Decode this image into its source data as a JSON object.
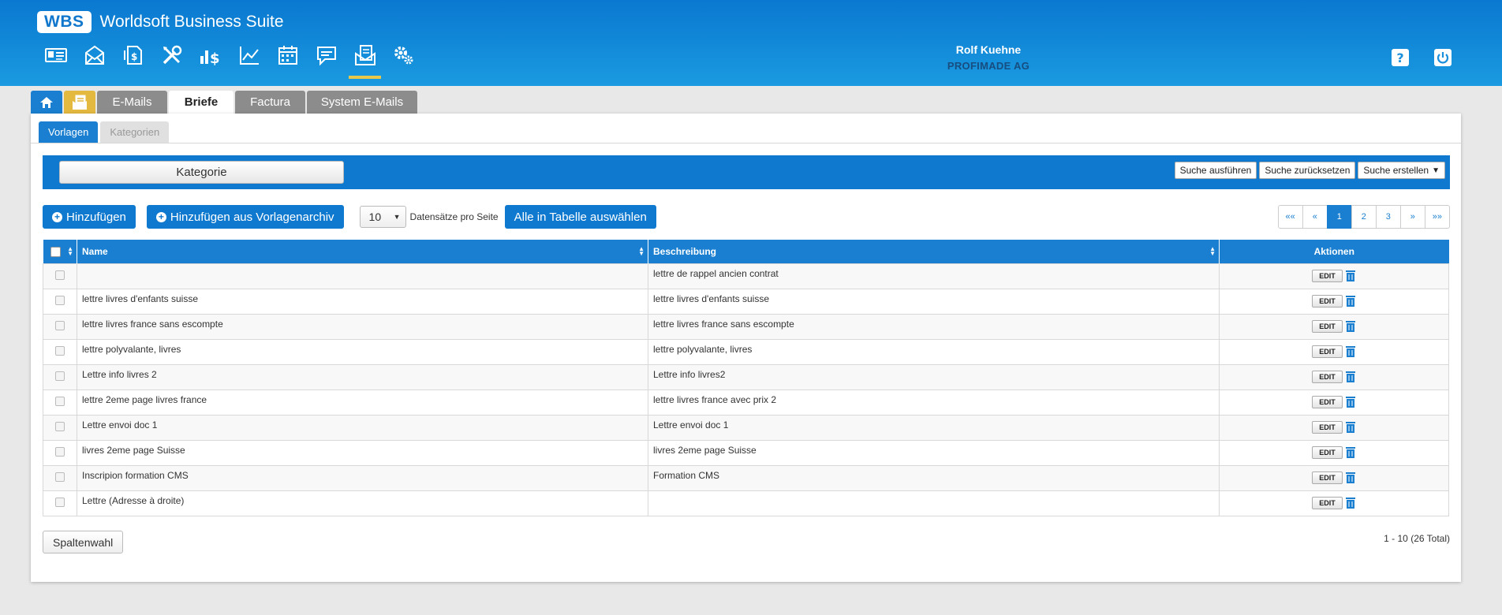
{
  "app": {
    "logo": "WBS",
    "title": "Worldsoft Business Suite"
  },
  "nav_icons": [
    "contact-card-icon",
    "mail-icon",
    "invoice-icon",
    "tools-icon",
    "finance-icon",
    "chart-icon",
    "calendar-icon",
    "comment-icon",
    "letters-icon",
    "settings-icon"
  ],
  "user": {
    "name": "Rolf Kuehne",
    "company": "PROFIMADE AG"
  },
  "top_tabs": {
    "emails": "E-Mails",
    "briefe": "Briefe",
    "factura": "Factura",
    "system": "System E-Mails"
  },
  "sub_tabs": {
    "vorlagen": "Vorlagen",
    "kategorien": "Kategorien"
  },
  "filter": {
    "kategorie": "Kategorie",
    "run": "Suche ausführen",
    "reset": "Suche zurücksetzen",
    "create": "Suche erstellen"
  },
  "toolbar": {
    "add": "Hinzufügen",
    "add_archive": "Hinzufügen aus Vorlagenarchiv",
    "per_page": "10",
    "per_page_label": "Datensätze pro Seite",
    "select_all": "Alle in Tabelle auswählen"
  },
  "pager": {
    "first": "««",
    "prev": "«",
    "p1": "1",
    "p2": "2",
    "p3": "3",
    "next": "»",
    "last": "»»"
  },
  "table": {
    "headers": {
      "name": "Name",
      "description": "Beschreibung",
      "actions": "Aktionen"
    },
    "edit_label": "EDIT",
    "rows": [
      {
        "name": "",
        "description": "lettre de rappel ancien contrat"
      },
      {
        "name": "lettre livres d'enfants suisse",
        "description": "lettre livres d'enfants suisse"
      },
      {
        "name": "lettre livres france sans escompte",
        "description": "lettre livres france sans escompte"
      },
      {
        "name": "lettre polyvalante, livres",
        "description": "lettre polyvalante, livres"
      },
      {
        "name": "Lettre info livres 2",
        "description": "Lettre info livres2"
      },
      {
        "name": "lettre 2eme page livres france",
        "description": "lettre livres france avec prix 2"
      },
      {
        "name": "Lettre envoi doc 1",
        "description": "Lettre envoi doc 1"
      },
      {
        "name": "livres 2eme page Suisse",
        "description": "livres 2eme page Suisse"
      },
      {
        "name": "Inscripion formation CMS",
        "description": "Formation CMS"
      },
      {
        "name": "Lettre (Adresse à droite)",
        "description": ""
      }
    ]
  },
  "footer": {
    "columns_button": "Spaltenwahl",
    "total": "1 - 10 (26 Total)"
  }
}
